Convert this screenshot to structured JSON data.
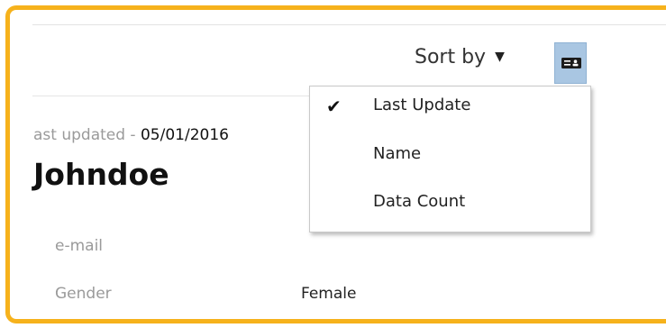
{
  "header": {
    "sort_label": "Sort by",
    "sort_caret": "▼",
    "view_toggle_icon": "contact-card-icon"
  },
  "record": {
    "last_updated_label": "ast updated - ",
    "last_updated_value": "05/01/2016",
    "name": "Johndoe",
    "fields": [
      {
        "label": "e-mail",
        "value": ""
      },
      {
        "label": "Gender",
        "value": "Female"
      }
    ]
  },
  "sort_menu": {
    "items": [
      {
        "label": "Last Update",
        "selected": true
      },
      {
        "label": "Name",
        "selected": false
      },
      {
        "label": "Data Count",
        "selected": false
      }
    ],
    "check_glyph": "✔"
  },
  "colors": {
    "frame_border": "#f6b21c",
    "toggle_bg": "#a9c6e2"
  }
}
